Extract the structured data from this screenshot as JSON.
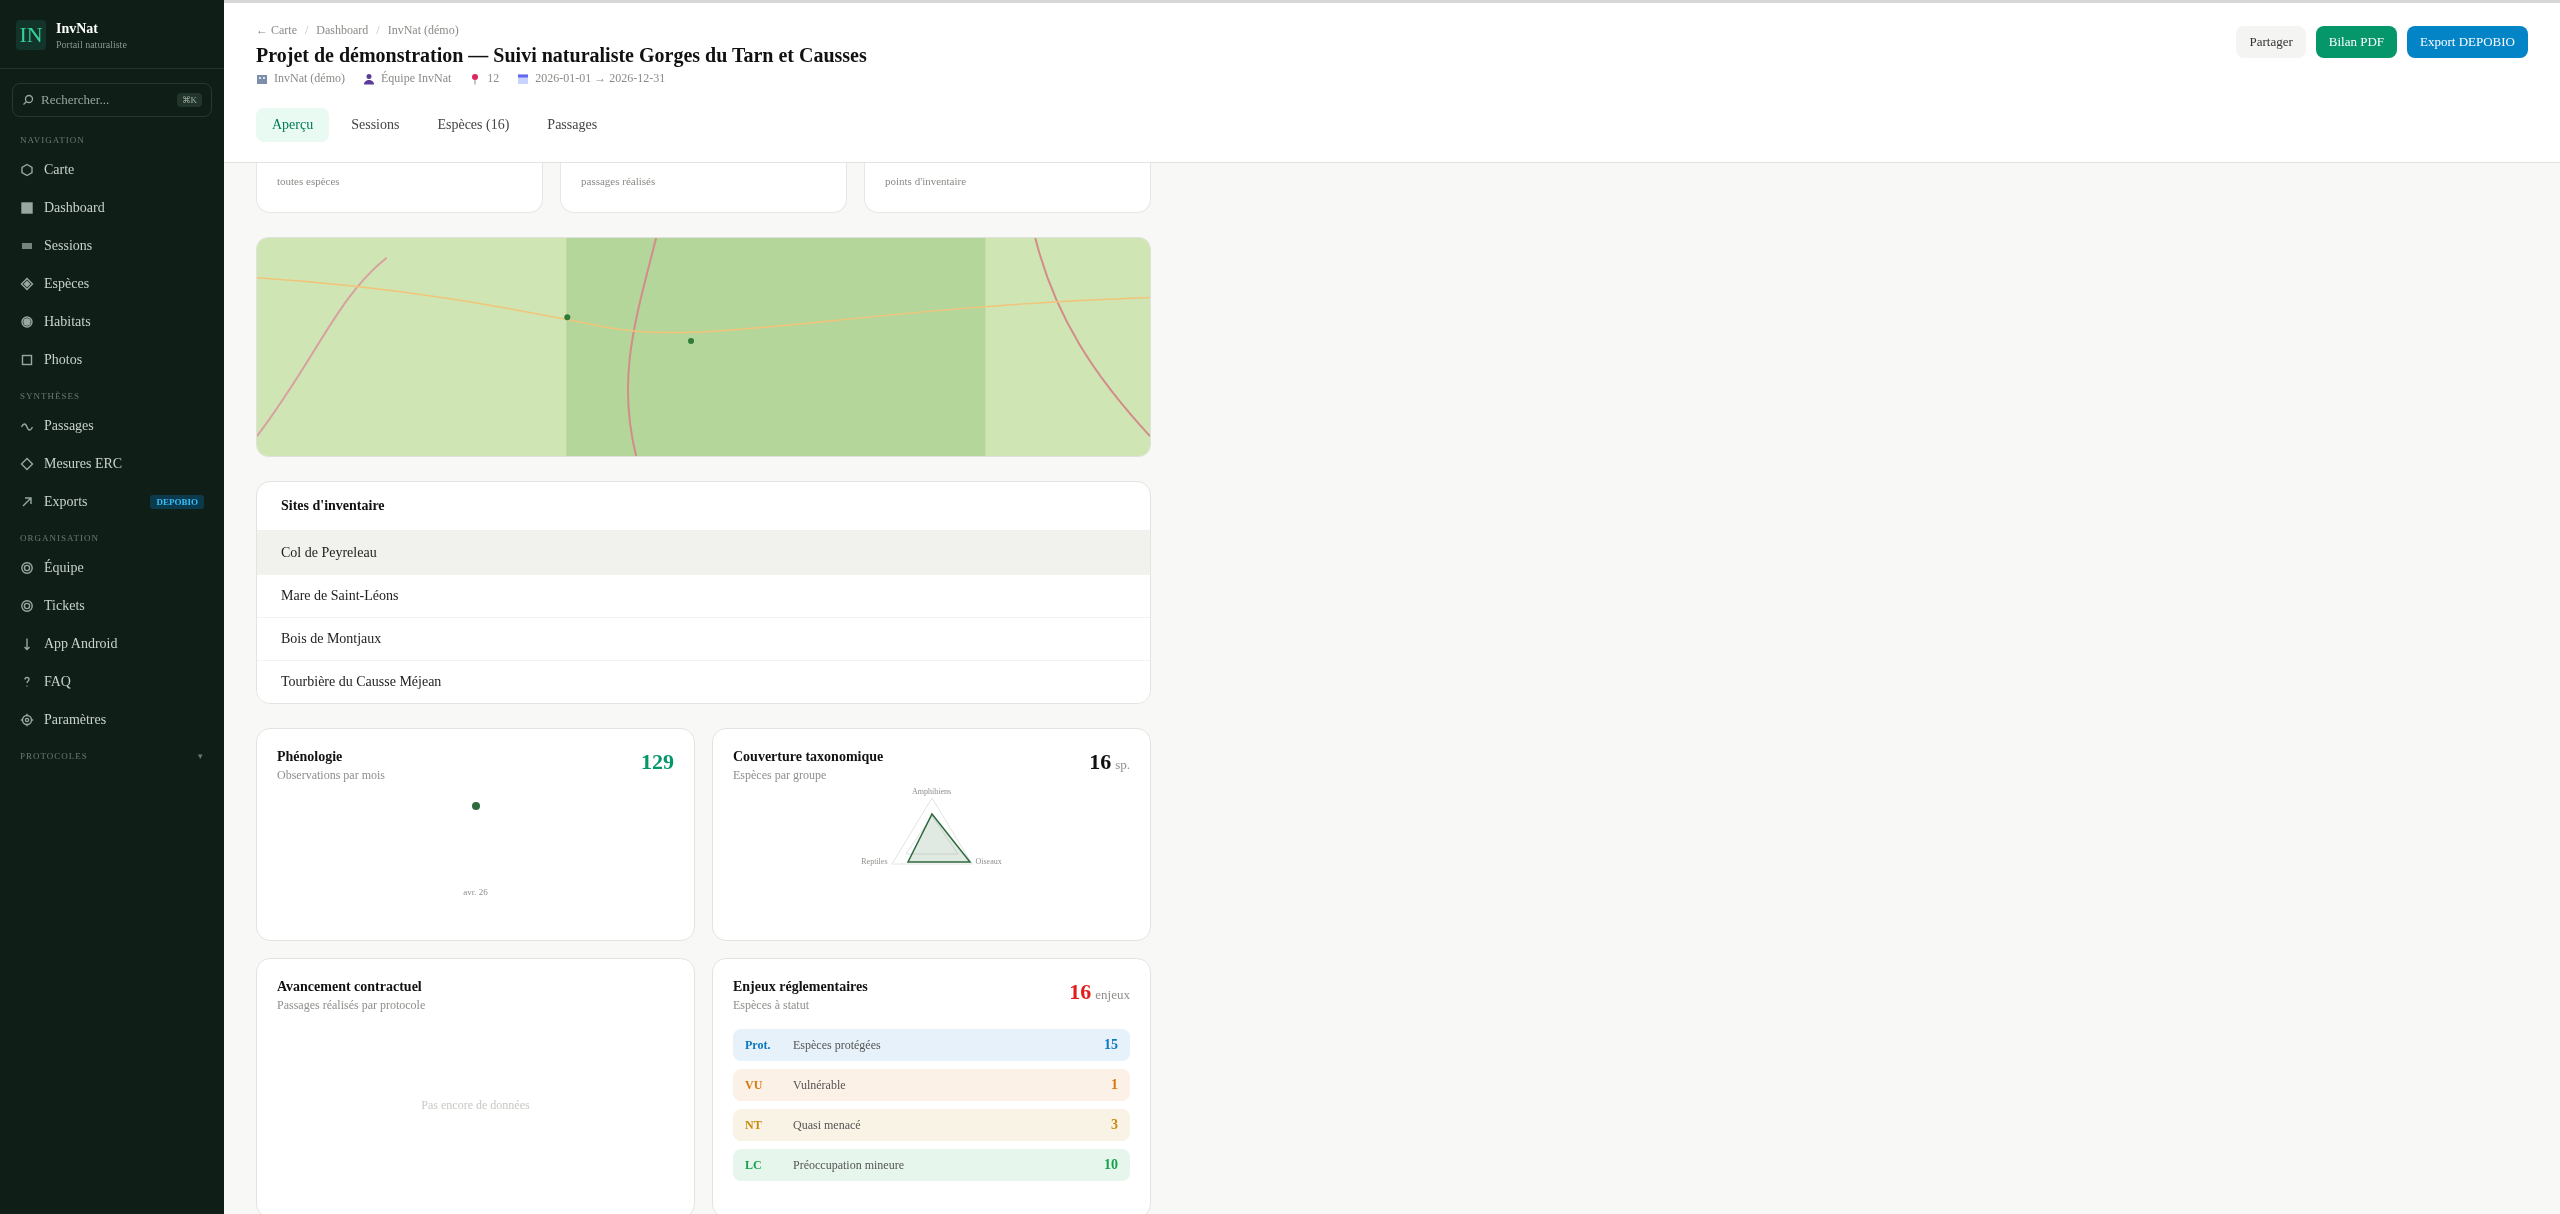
{
  "sidebar": {
    "logo": {
      "mark": "IN",
      "name": "InvNat",
      "tagline": "Portail naturaliste"
    },
    "search": {
      "placeholder": "Rechercher...",
      "shortcut": "⌘K"
    },
    "sections": [
      {
        "title": "NAVIGATION",
        "items": [
          {
            "label": "Carte"
          },
          {
            "label": "Dashboard"
          },
          {
            "label": "Sessions"
          },
          {
            "label": "Espèces"
          },
          {
            "label": "Habitats"
          },
          {
            "label": "Photos"
          }
        ]
      },
      {
        "title": "SYNTHÈSES",
        "items": [
          {
            "label": "Passages"
          },
          {
            "label": "Mesures ERC"
          },
          {
            "label": "Exports",
            "badge": "DEPOBIO"
          }
        ]
      },
      {
        "title": "ORGANISATION",
        "items": [
          {
            "label": "Équipe"
          },
          {
            "label": "Tickets"
          },
          {
            "label": "App Android"
          },
          {
            "label": "FAQ"
          },
          {
            "label": "Paramètres"
          }
        ]
      }
    ],
    "collapsed_section": {
      "title": "PROTOCOLES",
      "caret": "▾",
      "expanded": false
    }
  },
  "header": {
    "breadcrumb": [
      "← Carte",
      "Dashboard",
      "InvNat (démo)"
    ],
    "breadcrumb_separator": "/",
    "title": "Projet de démonstration — Suivi naturaliste Gorges du Tarn et Causses",
    "meta": [
      "InvNat (démo)",
      "Équipe InvNat",
      "12",
      "2026-01-01 → 2026-12-31"
    ],
    "actions": [
      {
        "label": "Partager",
        "kind": "plain"
      },
      {
        "label": "Bilan PDF",
        "kind": "green"
      },
      {
        "label": "Export DEPOBIO",
        "kind": "blue"
      }
    ],
    "tabs": [
      {
        "label": "Aperçu",
        "selected": true
      },
      {
        "label": "Sessions",
        "selected": false
      },
      {
        "label": "Espèces (16)",
        "selected": false
      },
      {
        "label": "Passages",
        "selected": false
      }
    ]
  },
  "stats": [
    {
      "caption": "toutes espèces"
    },
    {
      "caption": "passages réalisés"
    },
    {
      "caption": "points d'inventaire"
    }
  ],
  "sites": {
    "title": "Sites d'inventaire",
    "rows": [
      {
        "name": "Col de Peyreleau",
        "selected": true
      },
      {
        "name": "Mare de Saint-Léons",
        "selected": false
      },
      {
        "name": "Bois de Montjaux",
        "selected": false
      },
      {
        "name": "Tourbière du Causse Méjean",
        "selected": false
      }
    ]
  },
  "phenology": {
    "title": "Phénologie",
    "subtitle": "Observations par mois",
    "total": "129",
    "axis_label": "avr. 26"
  },
  "taxonomy": {
    "title": "Couverture taxonomique",
    "subtitle": "Espèces par groupe",
    "total": "16",
    "unit": "sp.",
    "axes": [
      "Amphibiens",
      "Oiseaux",
      "Reptiles"
    ]
  },
  "progress": {
    "title": "Avancement contractuel",
    "subtitle": "Passages réalisés par protocole",
    "empty": "Pas encore de données"
  },
  "issues": {
    "title": "Enjeux réglementaires",
    "subtitle": "Espèces à statut",
    "total": "16",
    "unit": "enjeux",
    "rows": [
      {
        "code": "Prot.",
        "label": "Espèces protégées",
        "count": "15",
        "color": "#0a78c2"
      },
      {
        "code": "VU",
        "label": "Vulnérable",
        "count": "1",
        "color": "#d9770a"
      },
      {
        "code": "NT",
        "label": "Quasi menacé",
        "count": "3",
        "color": "#c98a0a"
      },
      {
        "code": "LC",
        "label": "Préoccupation mineure",
        "count": "10",
        "color": "#16a34a"
      }
    ]
  }
}
